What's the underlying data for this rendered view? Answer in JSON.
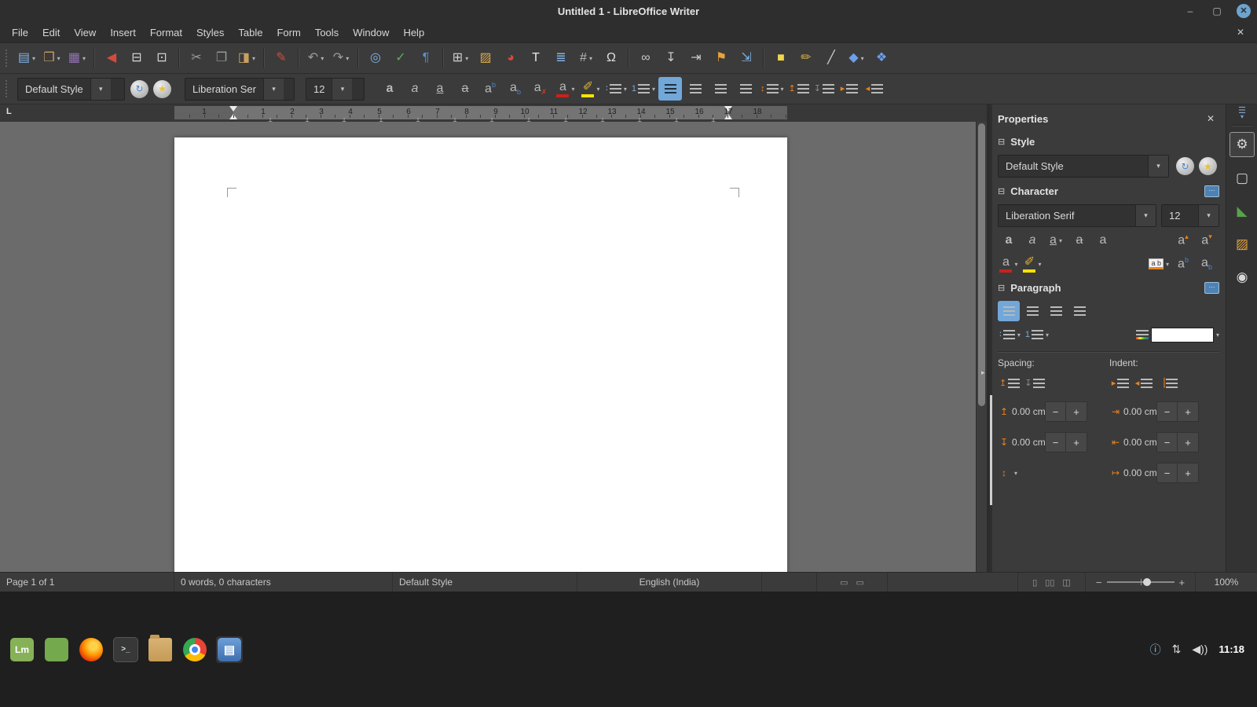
{
  "ui": {
    "dropdown_glyph": "▾",
    "minus_glyph": "−",
    "plus_glyph": "+",
    "collapse_arrow_glyph": "▸"
  },
  "window": {
    "title": "Untitled 1 - LibreOffice Writer",
    "controls": [
      {
        "name": "minimize-button",
        "glyph": "–"
      },
      {
        "name": "maximize-button",
        "glyph": "▢"
      },
      {
        "name": "close-button",
        "glyph": "✕"
      }
    ]
  },
  "menubar": {
    "items": [
      "File",
      "Edit",
      "View",
      "Insert",
      "Format",
      "Styles",
      "Table",
      "Form",
      "Tools",
      "Window",
      "Help"
    ],
    "close_document_glyph": "✕"
  },
  "toolbar": {
    "buttons": [
      {
        "name": "new-document",
        "glyph": "▤",
        "color": "#7fb2e5",
        "dropdown": true
      },
      {
        "name": "open",
        "glyph": "❒",
        "color": "#c8a061",
        "dropdown": true
      },
      {
        "name": "save",
        "glyph": "▦",
        "color": "#9272b5",
        "dropdown": true,
        "sep": true
      },
      {
        "name": "export-pdf",
        "glyph": "◀",
        "color": "#d24b3e"
      },
      {
        "name": "print",
        "glyph": "⊟",
        "color": "#d8d8d8"
      },
      {
        "name": "print-preview",
        "glyph": "⊡",
        "color": "#d8d8d8",
        "sep": true
      },
      {
        "name": "cut",
        "glyph": "✂",
        "color": "#9d9d9d"
      },
      {
        "name": "copy",
        "glyph": "❐",
        "color": "#9d9d9d"
      },
      {
        "name": "paste",
        "glyph": "◨",
        "color": "#c8a061",
        "dropdown": true,
        "sep": true
      },
      {
        "name": "clone-formatting",
        "glyph": "✎",
        "color": "#d24b3e",
        "sep": true
      },
      {
        "name": "undo",
        "glyph": "↶",
        "color": "#9d9d9d",
        "dropdown": true
      },
      {
        "name": "redo",
        "glyph": "↷",
        "color": "#9d9d9d",
        "dropdown": true,
        "sep": true
      },
      {
        "name": "find-replace",
        "glyph": "◎",
        "color": "#7fb2e5"
      },
      {
        "name": "spelling-check",
        "glyph": "✓",
        "color": "#58b158"
      },
      {
        "name": "formatting-marks",
        "glyph": "¶",
        "color": "#5b8fd6",
        "sep": true
      },
      {
        "name": "insert-table",
        "glyph": "⊞",
        "color": "#d0d0d0",
        "dropdown": true
      },
      {
        "name": "insert-image",
        "glyph": "▨",
        "color": "#d9a84e"
      },
      {
        "name": "insert-chart",
        "glyph": "◕",
        "color": "#d24b3e"
      },
      {
        "name": "insert-text-box",
        "glyph": "T",
        "color": "#e8e8e8"
      },
      {
        "name": "insert-page-break",
        "glyph": "≣",
        "color": "#7fb2e5"
      },
      {
        "name": "insert-field",
        "glyph": "#",
        "color": "#b9b9b9",
        "dropdown": true
      },
      {
        "name": "insert-special-character",
        "glyph": "Ω",
        "color": "#e0e0e0",
        "sep": true
      },
      {
        "name": "insert-hyperlink",
        "glyph": "∞",
        "color": "#c9c9c9"
      },
      {
        "name": "insert-footnote",
        "glyph": "↧",
        "color": "#c9c9c9"
      },
      {
        "name": "insert-endnote",
        "glyph": "⇥",
        "color": "#c9c9c9"
      },
      {
        "name": "insert-bookmark",
        "glyph": "⚑",
        "color": "#e8a33d"
      },
      {
        "name": "insert-cross-reference",
        "glyph": "⇲",
        "color": "#7fb2e5",
        "sep": true
      },
      {
        "name": "insert-comment",
        "glyph": "■",
        "color": "#f2d64b"
      },
      {
        "name": "track-changes",
        "glyph": "✏",
        "color": "#d8b13c"
      },
      {
        "name": "insert-line",
        "glyph": "╱",
        "color": "#d0d0d0"
      },
      {
        "name": "basic-shapes",
        "glyph": "◆",
        "color": "#6d9eeb",
        "dropdown": true
      },
      {
        "name": "show-draw-functions",
        "glyph": "❖",
        "color": "#6d9eeb"
      }
    ]
  },
  "format_toolbar": {
    "style_combo_value": "Default Style",
    "style_actions": [
      {
        "name": "update-style",
        "glyph": "↻",
        "color": "#4a86c8"
      },
      {
        "name": "new-style",
        "glyph": "★",
        "color": "#e8c13d"
      }
    ],
    "font_combo_value": "Liberation Ser",
    "size_combo_value": "12",
    "buttons": [
      {
        "name": "bold",
        "type": "letter",
        "glyph": "a",
        "style": "fb"
      },
      {
        "name": "italic",
        "type": "letter",
        "glyph": "a",
        "style": "fi"
      },
      {
        "name": "underline",
        "type": "letter",
        "glyph": "a",
        "style": "fu"
      },
      {
        "name": "strikethrough",
        "type": "letter",
        "glyph": "a",
        "style": "fs"
      },
      {
        "name": "superscript",
        "type": "pair",
        "base": "a",
        "mark": "b",
        "pos": "sup",
        "mark_color": "#4a86c8"
      },
      {
        "name": "subscript",
        "type": "pair",
        "base": "a",
        "mark": "b",
        "pos": "sub",
        "mark_color": "#4a86c8"
      },
      {
        "name": "clear-formatting",
        "type": "pair",
        "base": "a",
        "mark": "✗",
        "pos": "sub",
        "mark_color": "#d23b2f"
      },
      {
        "name": "font-color",
        "type": "colorbar",
        "base": "a",
        "base_color": "#b9b9b9",
        "bar": "#c9211e",
        "dropdown": true
      },
      {
        "name": "highlight-color",
        "type": "colorbar",
        "base": "✐",
        "base_color": "#d8b13c",
        "bar": "#f7e200",
        "dropdown": true
      },
      {
        "name": "unordered-list",
        "type": "lines",
        "prefix": "∶",
        "prefix_color": "#7fa7d0",
        "dropdown": true
      },
      {
        "name": "ordered-list",
        "type": "lines",
        "prefix": "1",
        "prefix_color": "#7fa7d0",
        "dropdown": true
      },
      {
        "name": "align-left",
        "type": "lines",
        "active": true
      },
      {
        "name": "align-center",
        "type": "lines"
      },
      {
        "name": "align-right",
        "type": "lines"
      },
      {
        "name": "align-justify",
        "type": "lines"
      },
      {
        "name": "line-spacing",
        "type": "lines",
        "prefix": "↕",
        "prefix_color": "#e8821e",
        "dropdown": true
      },
      {
        "name": "paragraph-spacing-increase",
        "type": "lines",
        "prefix": "↥",
        "prefix_color": "#e8821e"
      },
      {
        "name": "paragraph-spacing-decrease",
        "type": "lines",
        "prefix": "↧",
        "prefix_color": "#8a8a8a"
      },
      {
        "name": "increase-indent",
        "type": "lines",
        "prefix": "▸",
        "prefix_color": "#e8821e"
      },
      {
        "name": "decrease-indent",
        "type": "lines",
        "prefix": "◂",
        "prefix_color": "#e8821e"
      }
    ]
  },
  "ruler": {
    "margin_number": "1",
    "numbers": [
      "1",
      "2",
      "3",
      "4",
      "5",
      "6",
      "7",
      "8",
      "9",
      "10",
      "11",
      "12",
      "13",
      "14",
      "15",
      "16",
      "17",
      "18"
    ],
    "tab_mark_glyph": "⊥",
    "tab_type_glyph": "L"
  },
  "sidebar": {
    "title": "Properties",
    "close_glyph": "✕",
    "collapse_glyph": "⊟",
    "dialog_launcher_glyph": "···",
    "settings_glyph": "☰",
    "style_section": {
      "label": "Style",
      "combo_value": "Default Style",
      "actions": [
        {
          "name": "update-style",
          "glyph": "↻",
          "color": "#4a86c8"
        },
        {
          "name": "new-style",
          "glyph": "★",
          "color": "#e8c13d"
        }
      ]
    },
    "character_section": {
      "label": "Character",
      "font_value": "Liberation Serif",
      "size_value": "12",
      "row1": [
        {
          "name": "bold",
          "type": "letter",
          "glyph": "a",
          "style": "fb"
        },
        {
          "name": "italic",
          "type": "letter",
          "glyph": "a",
          "style": "fi"
        },
        {
          "name": "underline",
          "type": "letter",
          "glyph": "a",
          "style": "fu",
          "dropdown": true
        },
        {
          "name": "strikethrough",
          "type": "letter",
          "glyph": "a",
          "style": "fs"
        },
        {
          "name": "shadow",
          "type": "letter",
          "glyph": "a",
          "style": ""
        }
      ],
      "row1_right": [
        {
          "name": "increase-font-size",
          "type": "pair",
          "base": "a",
          "mark": "▴",
          "pos": "sup",
          "mark_color": "#e8821e"
        },
        {
          "name": "decrease-font-size",
          "type": "pair",
          "base": "a",
          "mark": "▾",
          "pos": "sup",
          "mark_color": "#e8821e"
        }
      ],
      "row2": [
        {
          "name": "font-color",
          "type": "colorbar",
          "base": "a",
          "base_color": "#b9b9b9",
          "bar": "#c9211e",
          "dropdown": true
        },
        {
          "name": "highlight-color",
          "type": "colorbar",
          "base": "✐",
          "base_color": "#d8b13c",
          "bar": "#f7e200",
          "dropdown": true
        }
      ],
      "row2_right": [
        {
          "name": "character-spacing",
          "type": "boxed",
          "base": "a b",
          "dropdown": true
        },
        {
          "name": "superscript",
          "type": "pair",
          "base": "a",
          "mark": "b",
          "pos": "sup",
          "mark_color": "#4a86c8"
        },
        {
          "name": "subscript",
          "type": "pair",
          "base": "a",
          "mark": "b",
          "pos": "sub",
          "mark_color": "#4a86c8"
        }
      ]
    },
    "paragraph_section": {
      "label": "Paragraph",
      "align": [
        {
          "name": "align-left",
          "active": true
        },
        {
          "name": "align-center"
        },
        {
          "name": "align-right"
        },
        {
          "name": "align-justify"
        }
      ],
      "lists": [
        {
          "name": "unordered-list",
          "prefix": "∶",
          "prefix_color": "#7fa7d0",
          "dropdown": true
        },
        {
          "name": "ordered-list",
          "prefix": "1",
          "prefix_color": "#7fa7d0",
          "dropdown": true
        }
      ],
      "spacing_label": "Spacing:",
      "indent_label": "Indent:",
      "spacing_icons": [
        {
          "name": "paragraph-spacing-increase",
          "prefix": "↥",
          "prefix_color": "#e8821e"
        },
        {
          "name": "paragraph-spacing-decrease",
          "prefix": "↧",
          "prefix_color": "#8a8a8a"
        }
      ],
      "indent_icons": [
        {
          "name": "increase-indent",
          "prefix": "▸",
          "prefix_color": "#e8821e"
        },
        {
          "name": "decrease-indent",
          "prefix": "◂",
          "prefix_color": "#e8821e"
        },
        {
          "name": "hanging-indent",
          "prefix": "▕",
          "prefix_color": "#e8821e"
        }
      ],
      "spacing_above": "0.00 cm",
      "spacing_below": "0.00 cm",
      "indent_before": "0.00 cm",
      "indent_after": "0.00 cm",
      "indent_first_line": "0.00 cm",
      "spin_rows": [
        {
          "name": "spacing-above",
          "icon": "↥",
          "key": "spacing_above"
        },
        {
          "name": "indent-before-text",
          "icon": "⇥",
          "key": "indent_before"
        },
        {
          "name": "spacing-below",
          "icon": "↧",
          "key": "spacing_below"
        },
        {
          "name": "indent-after-text",
          "icon": "⇤",
          "key": "indent_after"
        },
        {
          "name": "line-spacing",
          "icon": "↕",
          "key": null,
          "dropdown": true
        },
        {
          "name": "indent-first-line",
          "icon": "↦",
          "key": "indent_first_line"
        }
      ]
    },
    "deck_tabs": [
      {
        "name": "tab-properties",
        "glyph": "⚙",
        "active": true
      },
      {
        "name": "tab-page",
        "glyph": "▢"
      },
      {
        "name": "tab-styles",
        "glyph": "◣",
        "color": "#5aa14b"
      },
      {
        "name": "tab-gallery",
        "glyph": "▨",
        "color": "#e0a13d"
      },
      {
        "name": "tab-navigator",
        "glyph": "◉"
      }
    ]
  },
  "statusbar": {
    "page_label": "Page 1 of 1",
    "word_count": "0 words, 0 characters",
    "page_style": "Default Style",
    "language": "English (India)",
    "zoom_level": "100%",
    "selection_icons": [
      {
        "name": "selection-mode-icon",
        "glyph": "▭"
      },
      {
        "name": "document-modified-icon",
        "glyph": "▭"
      }
    ],
    "view_buttons": [
      {
        "name": "single-page-view",
        "glyph": "▯"
      },
      {
        "name": "multi-page-view",
        "glyph": "▯▯"
      },
      {
        "name": "book-view",
        "glyph": "◫"
      }
    ]
  },
  "taskbar": {
    "items": [
      {
        "name": "mint-menu",
        "cls": "ic-mint",
        "label": "Lm"
      },
      {
        "name": "green-app",
        "cls": "ic-green",
        "label": ""
      },
      {
        "name": "firefox",
        "cls": "ic-firefox",
        "label": ""
      },
      {
        "name": "terminal",
        "cls": "ic-term",
        "label": ">_"
      },
      {
        "name": "file-manager",
        "cls": "ic-folder",
        "label": ""
      },
      {
        "name": "chrome",
        "cls": "ic-chrome",
        "label": ""
      },
      {
        "name": "libreoffice-writer",
        "cls": "ic-writer",
        "label": "▤",
        "active": true
      }
    ],
    "tray": [
      {
        "name": "security-shield-icon",
        "glyph": "ⓘ",
        "color": "#8ec0e8"
      },
      {
        "name": "network-icon",
        "glyph": "⇅",
        "color": "#d8d8d8"
      },
      {
        "name": "volume-icon",
        "glyph": "◀))",
        "color": "#d8d8d8"
      }
    ],
    "time": "11:18"
  }
}
